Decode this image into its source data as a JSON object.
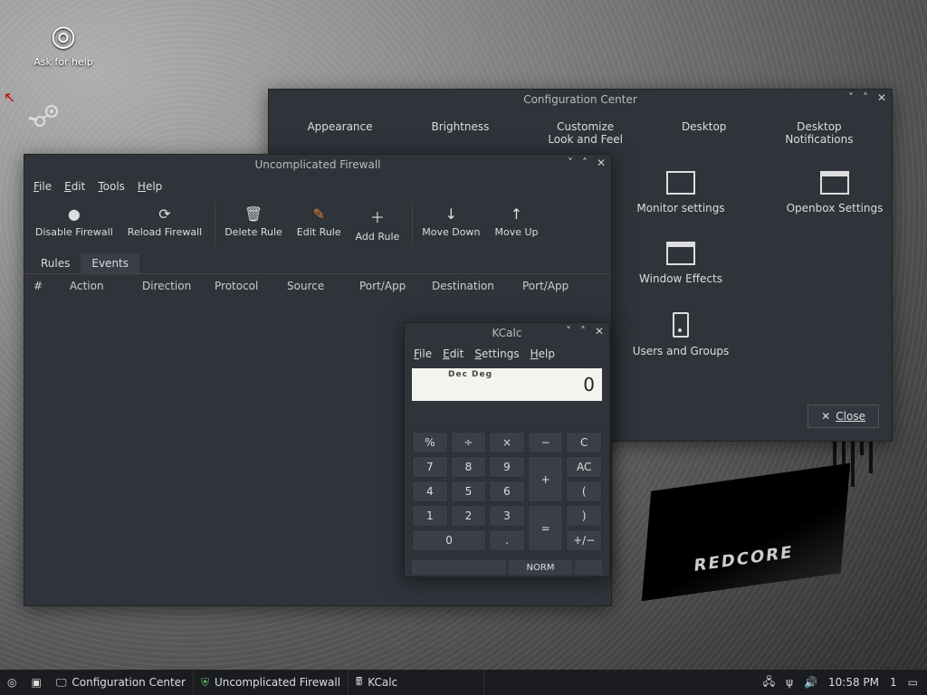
{
  "desktop": {
    "ask_label": "Ask for help",
    "redcore": "REDCORE"
  },
  "config_center": {
    "title": "Configuration Center",
    "categories": [
      "Appearance",
      "Brightness",
      "Customize\nLook and Feel",
      "Desktop",
      "Desktop\nNotifications"
    ],
    "items": {
      "monitor": "Monitor settings",
      "openbox": "Openbox Settings",
      "wineff": "Window Effects",
      "users": "Users and Groups"
    },
    "close": "Close"
  },
  "firewall": {
    "title": "Uncomplicated Firewall",
    "menu": [
      "File",
      "Edit",
      "Tools",
      "Help"
    ],
    "toolbar": {
      "disable": "Disable Firewall",
      "reload": "Reload Firewall",
      "delete": "Delete Rule",
      "edit": "Edit Rule",
      "add": "Add Rule",
      "down": "Move Down",
      "up": "Move Up"
    },
    "tabs": [
      "Rules",
      "Events"
    ],
    "columns": [
      "#",
      "Action",
      "Direction",
      "Protocol",
      "Source",
      "Port/App",
      "Destination",
      "Port/App"
    ]
  },
  "kcalc": {
    "title": "KCalc",
    "menu": [
      "File",
      "Edit",
      "Settings",
      "Help"
    ],
    "mode": "Dec  Deg",
    "display": "0",
    "keys": {
      "pct": "%",
      "div": "÷",
      "mul": "×",
      "sub": "−",
      "clr": "C",
      "k7": "7",
      "k8": "8",
      "k9": "9",
      "add": "+",
      "ac": "AC",
      "k4": "4",
      "k5": "5",
      "k6": "6",
      "lp": "(",
      "k1": "1",
      "k2": "2",
      "k3": "3",
      "eq": "=",
      "rp": ")",
      "k0": "0",
      "dot": ".",
      "pm": "+/−"
    },
    "status": "NORM"
  },
  "taskbar": {
    "tasks": [
      "Configuration Center",
      "Uncomplicated Firewall",
      "KCalc"
    ],
    "clock": "10:58 PM",
    "ws": "1"
  }
}
